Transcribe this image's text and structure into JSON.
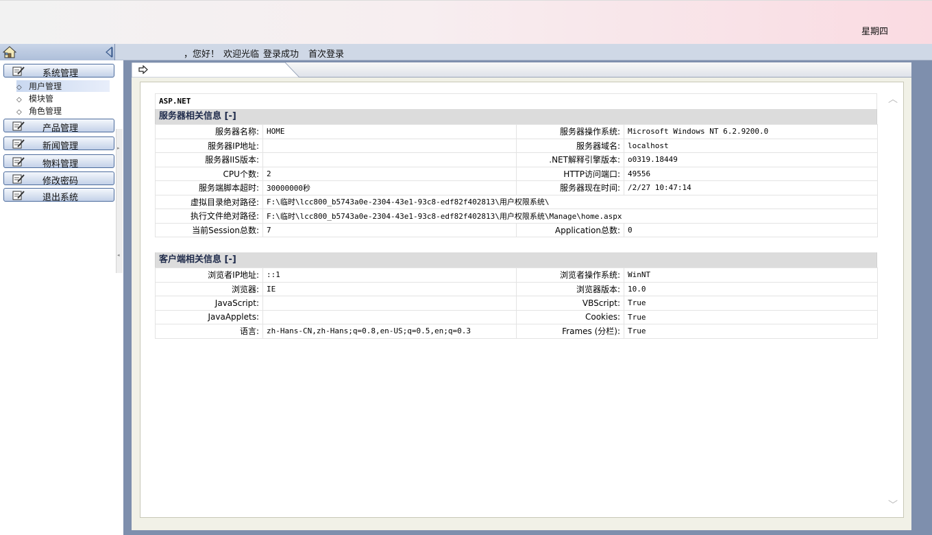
{
  "header": {
    "weekday": "星期四"
  },
  "infobar": {
    "greeting": "，您好！",
    "welcome": "欢迎光临",
    "login_status": "登录成功",
    "first_login": "首次登录"
  },
  "sidebar": {
    "menus": [
      {
        "label": "系统管理",
        "icon": "edit-icon"
      },
      {
        "label": "产品管理",
        "icon": "edit-icon"
      },
      {
        "label": "新闻管理",
        "icon": "edit-icon"
      },
      {
        "label": "物料管理",
        "icon": "edit-icon"
      },
      {
        "label": "修改密码",
        "icon": "edit-icon"
      },
      {
        "label": "退出系统",
        "icon": "edit-icon"
      }
    ],
    "sub_items": [
      {
        "label": "用户管理",
        "selected": true
      },
      {
        "label": "模块管"
      },
      {
        "label": "角色管理"
      }
    ]
  },
  "main": {
    "asp_title": "ASP.NET",
    "server": {
      "title": "服务器相关信息 [-]",
      "rows": [
        {
          "k1": "服务器名称:",
          "v1": "HOME",
          "k2": "服务器操作系统:",
          "v2": "Microsoft Windows NT 6.2.9200.0"
        },
        {
          "k1": "服务器IP地址:",
          "v1": "",
          "k2": "服务器域名:",
          "v2": "localhost"
        },
        {
          "k1": "服务器IIS版本:",
          "v1": "",
          "k2": ".NET解释引擎版本:",
          "v2": "o0319.18449"
        },
        {
          "k1": "CPU个数:",
          "v1": "2",
          "k2": "HTTP访问端口:",
          "v2": "49556"
        },
        {
          "k1": "服务端脚本超时:",
          "v1": "30000000秒",
          "k2": "服务器现在时间:",
          "v2": "/2/27 10:47:14"
        }
      ],
      "full_rows": [
        {
          "k": "虚拟目录绝对路径:",
          "v": "F:\\临时\\lcc800_b5743a0e-2304-43e1-93c8-edf82f402813\\用户权限系统\\"
        },
        {
          "k": "执行文件绝对路径:",
          "v": "F:\\临时\\lcc800_b5743a0e-2304-43e1-93c8-edf82f402813\\用户权限系统\\Manage\\home.aspx"
        }
      ],
      "last_row": {
        "k1": "当前Session总数:",
        "v1": "7",
        "k2": "Application总数:",
        "v2": "0"
      }
    },
    "client": {
      "title": "客户端相关信息 [-]",
      "rows": [
        {
          "k1": "浏览者IP地址:",
          "v1": "::1",
          "k2": "浏览者操作系统:",
          "v2": "WinNT"
        },
        {
          "k1": "浏览器:",
          "v1": "IE",
          "k2": "浏览器版本:",
          "v2": "10.0"
        },
        {
          "k1": "JavaScript:",
          "v1": "",
          "k2": "VBScript:",
          "v2": "True"
        },
        {
          "k1": "JavaApplets:",
          "v1": "",
          "k2": "Cookies:",
          "v2": "True"
        },
        {
          "k1": "语言:",
          "v1": "zh-Hans-CN,zh-Hans;q=0.8,en-US;q=0.5,en;q=0.3",
          "k2": "Frames (分栏):",
          "v2": "True"
        }
      ]
    }
  }
}
